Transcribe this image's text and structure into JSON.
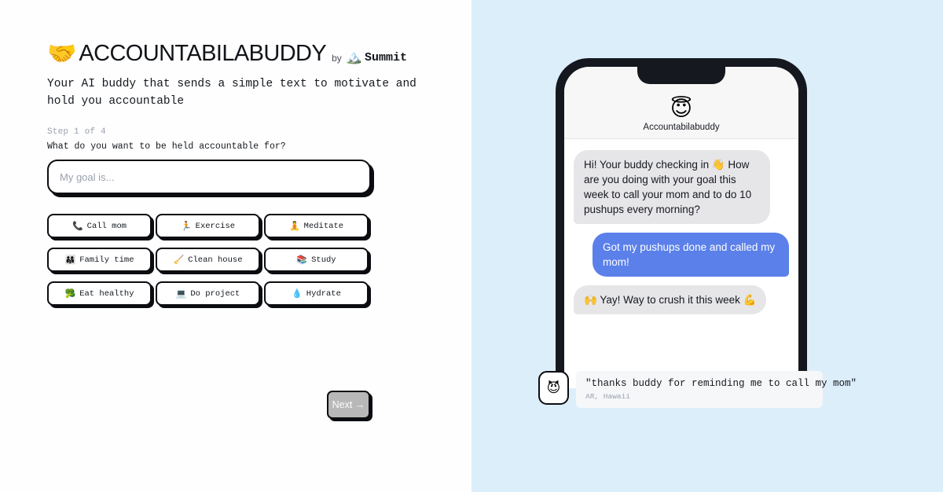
{
  "brand": {
    "logo_emoji": "🤝",
    "title": "ACCOUNTABILABUDDY",
    "by_label": "by",
    "summit_emoji": "🏔️",
    "summit_label": "Summit",
    "tagline": "Your AI buddy that sends a simple text to motivate and hold you accountable"
  },
  "form": {
    "step_label": "Step 1 of 4",
    "question": "What do you want to be held accountable for?",
    "goal_value": "",
    "goal_placeholder": "My goal is...",
    "next_label": "Next →",
    "chips": [
      {
        "emoji": "📞",
        "label": "Call mom"
      },
      {
        "emoji": "🏃",
        "label": "Exercise"
      },
      {
        "emoji": "🧘",
        "label": "Meditate"
      },
      {
        "emoji": "👨‍👩‍👧",
        "label": "Family time"
      },
      {
        "emoji": "🧹",
        "label": "Clean house"
      },
      {
        "emoji": "📚",
        "label": "Study"
      },
      {
        "emoji": "🥦",
        "label": "Eat healthy"
      },
      {
        "emoji": "💻",
        "label": "Do project"
      },
      {
        "emoji": "💧",
        "label": "Hydrate"
      }
    ]
  },
  "phone": {
    "avatar_emoji": "😇",
    "contact_name": "Accountabilabuddy",
    "messages": [
      {
        "direction": "in",
        "text": "Hi! Your buddy checking in 👋 How are you doing with your goal this week to call your mom and to do 10 pushups every morning?"
      },
      {
        "direction": "out",
        "text": "Got my pushups done and called my mom!"
      },
      {
        "direction": "in",
        "text": "🙌 Yay!  Way to crush it this week 💪"
      }
    ]
  },
  "testimonial": {
    "avatar_emoji": "😈",
    "quote": "\"thanks buddy for reminding me to call my mom\"",
    "author": "AR, Hawaii"
  },
  "colors": {
    "right_panel_bg": "#ddeefb",
    "outgoing_bubble": "#5b80ea",
    "incoming_bubble": "#e6e6e9",
    "phone_bezel": "#16181f",
    "ink": "#0b0d10",
    "muted": "#9aa1ad",
    "disabled_button": "#b8b8b8"
  }
}
